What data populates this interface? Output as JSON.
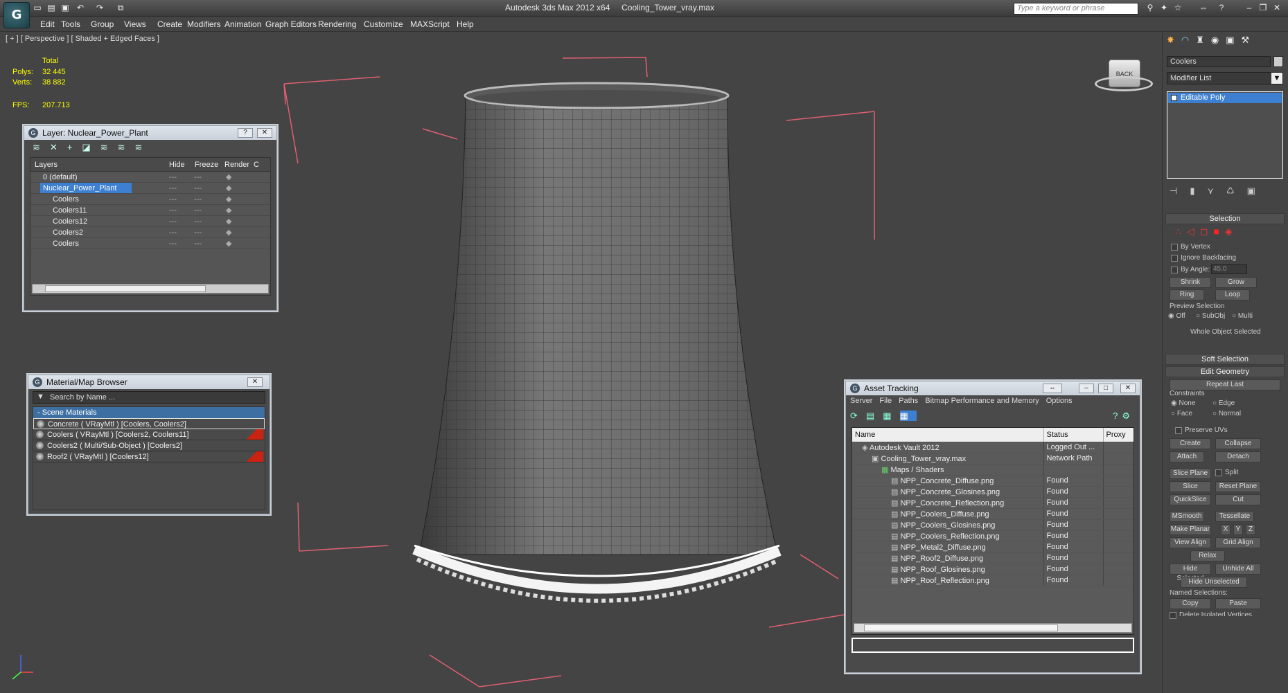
{
  "app": {
    "title": "Autodesk 3ds Max  2012 x64",
    "file": "Cooling_Tower_vray.max",
    "search_placeholder": "Type a keyword or phrase",
    "logo": "3ds-max-logo"
  },
  "menu": [
    "Edit",
    "Tools",
    "Group",
    "Views",
    "Create",
    "Modifiers",
    "Animation",
    "Graph Editors",
    "Rendering",
    "Customize",
    "MAXScript",
    "Help"
  ],
  "viewport": {
    "label": "[ + ] [ Perspective ] [ Shaded + Edged Faces ]",
    "stats": {
      "total": "Total",
      "polys_label": "Polys:",
      "polys": "32 445",
      "verts_label": "Verts:",
      "verts": "38 882",
      "fps_label": "FPS:",
      "fps": "207.713"
    },
    "viewcube": "BACK",
    "bg": "#444444"
  },
  "layer_panel": {
    "title": "Layer: Nuclear_Power_Plant",
    "cols": [
      "Layers",
      "Hide",
      "Freeze",
      "Render",
      "C"
    ],
    "rows": [
      {
        "name": "0 (default)",
        "indent": 1
      },
      {
        "name": "Nuclear_Power_Plant",
        "indent": 1,
        "selected": true
      },
      {
        "name": "Coolers",
        "indent": 2
      },
      {
        "name": "Coolers11",
        "indent": 2
      },
      {
        "name": "Coolers12",
        "indent": 2
      },
      {
        "name": "Coolers2",
        "indent": 2
      },
      {
        "name": "Coolers",
        "indent": 2
      }
    ]
  },
  "material_panel": {
    "title": "Material/Map Browser",
    "search": "Search by Name ...",
    "group": "- Scene Materials",
    "items": [
      "Concrete  ( VRayMtl ) [Coolers, Coolers2]",
      "Coolers  ( VRayMtl ) [Coolers2, Coolers11]",
      "Coolers2  ( Multi/Sub-Object ) [Coolers2]",
      "Roof2  ( VRayMtl ) [Coolers12]"
    ]
  },
  "asset_panel": {
    "title": "Asset Tracking",
    "menu": [
      "Server",
      "File",
      "Paths",
      "Bitmap Performance and Memory",
      "Options"
    ],
    "cols": [
      "Name",
      "Status",
      "Proxy"
    ],
    "rows": [
      {
        "name": "Autodesk Vault 2012",
        "status": "Logged Out ...",
        "indent": 1
      },
      {
        "name": "Cooling_Tower_vray.max",
        "status": "Network Path",
        "indent": 2
      },
      {
        "name": "Maps / Shaders",
        "status": "",
        "indent": 3
      },
      {
        "name": "NPP_Concrete_Diffuse.png",
        "status": "Found",
        "indent": 4
      },
      {
        "name": "NPP_Concrete_Glosines.png",
        "status": "Found",
        "indent": 4
      },
      {
        "name": "NPP_Concrete_Reflection.png",
        "status": "Found",
        "indent": 4
      },
      {
        "name": "NPP_Coolers_Diffuse.png",
        "status": "Found",
        "indent": 4
      },
      {
        "name": "NPP_Coolers_Glosines.png",
        "status": "Found",
        "indent": 4
      },
      {
        "name": "NPP_Coolers_Reflection.png",
        "status": "Found",
        "indent": 4
      },
      {
        "name": "NPP_Metal2_Diffuse.png",
        "status": "Found",
        "indent": 4
      },
      {
        "name": "NPP_Roof2_Diffuse.png",
        "status": "Found",
        "indent": 4
      },
      {
        "name": "NPP_Roof_Glosines.png",
        "status": "Found",
        "indent": 4
      },
      {
        "name": "NPP_Roof_Reflection.png",
        "status": "Found",
        "indent": 4
      }
    ]
  },
  "cmd": {
    "object_name": "Coolers",
    "modifier_list": "Modifier List",
    "stack_item": "Editable Poly",
    "selection": {
      "title": "Selection",
      "by_vertex": "By Vertex",
      "ignore_backfacing": "Ignore Backfacing",
      "by_angle": "By Angle:",
      "angle": "45.0",
      "shrink": "Shrink",
      "grow": "Grow",
      "ring": "Ring",
      "loop": "Loop",
      "preview": "Preview Selection",
      "off": "Off",
      "subobj": "SubObj",
      "multi": "Multi",
      "status": "Whole Object Selected"
    },
    "soft_selection": "Soft Selection",
    "edit_geometry": "Edit Geometry",
    "repeat_last": "Repeat Last",
    "constraints": "Constraints",
    "none": "None",
    "edge": "Edge",
    "face": "Face",
    "normal": "Normal",
    "preserve_uvs": "Preserve UVs",
    "create": "Create",
    "collapse": "Collapse",
    "attach": "Attach",
    "detach": "Detach",
    "slice_plane": "Slice Plane",
    "split": "Split",
    "slice": "Slice",
    "reset_plane": "Reset Plane",
    "quickslice": "QuickSlice",
    "cut": "Cut",
    "msmooth": "MSmooth",
    "tessellate": "Tessellate",
    "make_planar": "Make Planar",
    "x": "X",
    "y": "Y",
    "z": "Z",
    "view_align": "View Align",
    "grid_align": "Grid Align",
    "relax": "Relax",
    "hide_selected": "Hide Selected",
    "unhide_all": "Unhide All",
    "hide_unselected": "Hide Unselected",
    "named_selections": "Named Selections:",
    "copy": "Copy",
    "paste": "Paste",
    "delete_isolated": "Delete Isolated Vertices"
  }
}
